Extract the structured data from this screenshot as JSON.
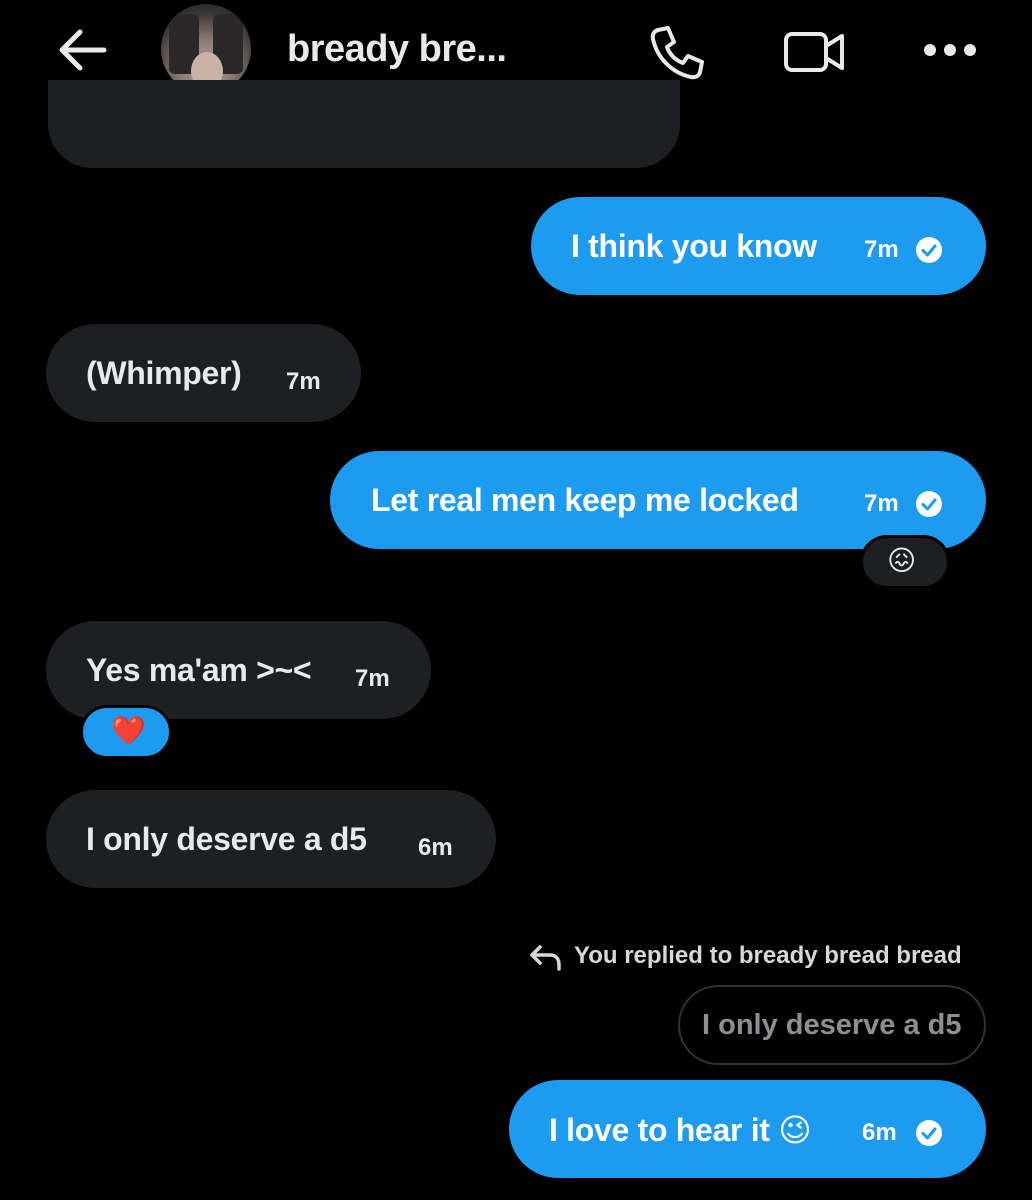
{
  "header": {
    "contact_name": "bready bre...",
    "back_icon": "arrow-left-icon",
    "call_icon": "phone-icon",
    "video_icon": "video-camera-icon",
    "more_icon": "more-horizontal-icon"
  },
  "colors": {
    "background": "#000000",
    "incoming_bubble": "#1d1f23",
    "outgoing_bubble": "#1d9bf0",
    "text": "#e7e9ea"
  },
  "messages": [
    {
      "direction": "outgoing",
      "text": "I think you know",
      "time": "7m",
      "status": "seen"
    },
    {
      "direction": "incoming",
      "text": "(Whimper)",
      "time": "7m"
    },
    {
      "direction": "outgoing",
      "text": "Let real men keep me locked",
      "time": "7m",
      "status": "seen",
      "reaction": "😖"
    },
    {
      "direction": "incoming",
      "text": "Yes ma'am >~<",
      "time": "7m",
      "reaction": "❤️"
    },
    {
      "direction": "incoming",
      "text": "I only deserve a d5",
      "time": "6m"
    },
    {
      "direction": "outgoing",
      "reply_label": "You replied to bready bread bread",
      "quoted_text": "I only deserve a d5",
      "text": "I love to hear it 😉",
      "time": "6m",
      "status": "seen"
    }
  ]
}
